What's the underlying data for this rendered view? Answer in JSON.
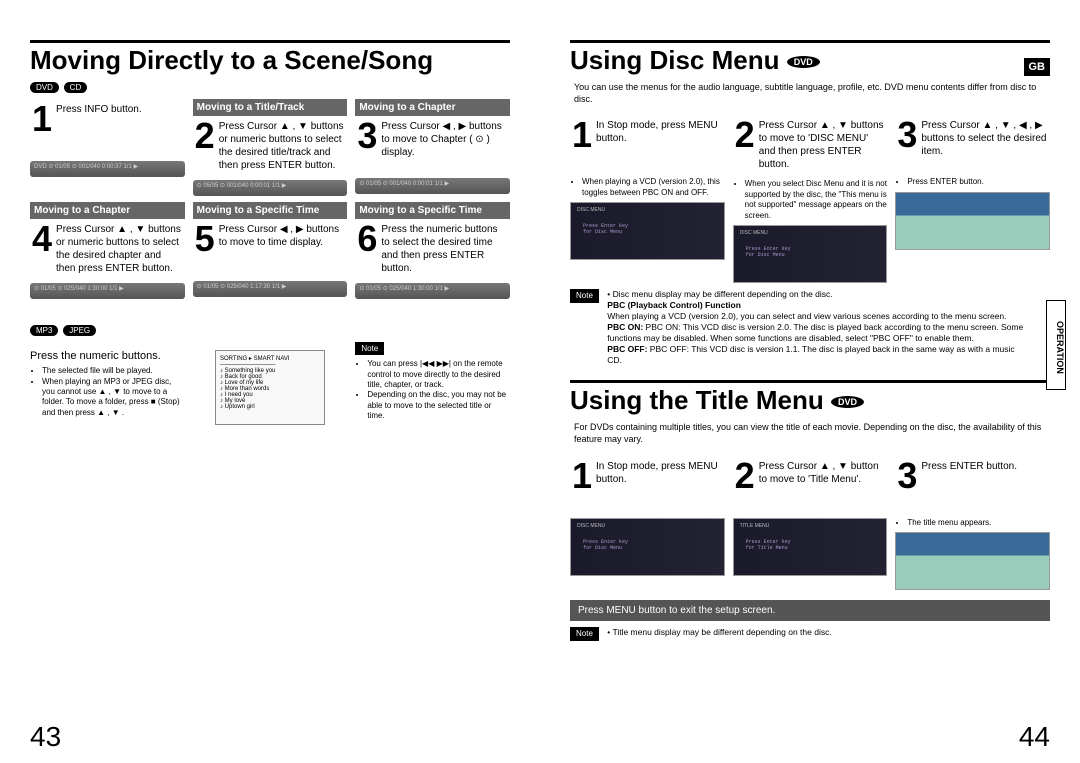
{
  "left": {
    "main_title_a": "Moving Directly to a Scene/Song",
    "pills": [
      "DVD",
      "CD"
    ],
    "row1": [
      {
        "num": "1",
        "head": "",
        "text": "Press INFO button."
      },
      {
        "num": "2",
        "head": "Moving to a Title/Track",
        "text": "Press Cursor ▲ , ▼ buttons or numeric buttons to select the desired title/track and then press ENTER button."
      },
      {
        "num": "3",
        "head": "Moving to a Chapter",
        "text": "Press Cursor ◀ , ▶ buttons to move to Chapter ( ⊙ ) display."
      }
    ],
    "row2": [
      {
        "num": "4",
        "head": "Moving to a Chapter",
        "text": "Press Cursor ▲ , ▼ buttons or numeric buttons to select the desired chapter and then press ENTER button."
      },
      {
        "num": "5",
        "head": "Moving to a Specific Time",
        "text": "Press Cursor ◀ , ▶ buttons to move to time display."
      },
      {
        "num": "6",
        "head": "Moving to a Specific Time",
        "text": "Press the numeric buttons to select the desired time and then press ENTER button."
      }
    ],
    "pills2": [
      "MP3",
      "JPEG"
    ],
    "numeric_text": "Press the numeric buttons.",
    "numeric_bullets": [
      "The selected file will be played.",
      "When playing an MP3 or JPEG disc, you cannot use ▲ , ▼ to move to a folder. To move a folder, press ■ (Stop) and then press ▲ , ▼ ."
    ],
    "note_label": "Note",
    "note_bullets": [
      "You can press |◀◀ ▶▶| on the remote control to move directly to the desired title, chapter, or track.",
      "Depending on the disc, you may not be able to move to the selected title or time."
    ],
    "page_num": "43"
  },
  "right": {
    "gb": "GB",
    "oper_tab": "OPERATION",
    "disc": {
      "title": "Using Disc Menu",
      "badge": "DVD",
      "sub": "You can use the menus for the audio language, subtitle language, profile, etc. DVD menu contents differ from disc to disc.",
      "steps": [
        {
          "num": "1",
          "text": "In Stop mode, press MENU button.",
          "bullet": "When playing a VCD (version 2.0), this toggles between PBC ON and OFF.",
          "tv_text": "Disc Menu\\n\\nPress Enter key\\nfor Disc Menu"
        },
        {
          "num": "2",
          "text": "Press Cursor ▲ , ▼ buttons to move to 'DISC MENU' and then press ENTER button.",
          "bullet": "When you select Disc Menu and it is not supported by the disc, the \"This menu is not supported\" message appears on the screen.",
          "tv_text": "Disc Menu\\n\\nPress Enter key\\nfor Disc Menu"
        },
        {
          "num": "3",
          "text": "Press Cursor ▲ , ▼ , ◀ , ▶ buttons to select the desired item.",
          "bullet": "Press ENTER button.",
          "dolphin": true
        }
      ],
      "note_label": "Note",
      "notes": [
        "Disc menu display may be different depending on the disc.",
        "PBC (Playback Control) Function",
        "When playing a VCD (version 2.0), you can select and view various scenes according to the menu screen.",
        "PBC ON: This VCD disc is version 2.0. The disc is played back according to the menu screen. Some functions may be disabled. When some functions are disabled, select \"PBC OFF\" to enable them.",
        "PBC OFF: This VCD disc is version 1.1. The disc is played back in the same way as with a music CD."
      ]
    },
    "title_menu": {
      "title": "Using the Title Menu",
      "badge": "DVD",
      "sub": "For DVDs containing multiple titles, you can view the title of each movie. Depending on the disc, the availability of this feature may vary.",
      "steps": [
        {
          "num": "1",
          "text": "In Stop mode, press MENU button.",
          "tv_text": "Disc Menu\\n\\nPress Enter key\\nfor Disc Menu"
        },
        {
          "num": "2",
          "text": "Press Cursor ▲ , ▼ button to move to 'Title Menu'.",
          "tv_text": "Title Menu\\n\\nPress Enter key\\nfor Title Menu"
        },
        {
          "num": "3",
          "text": "Press ENTER button.",
          "bullet": "The title menu appears.",
          "dolphin": true
        }
      ],
      "exit": "Press MENU button to exit the setup screen.",
      "note_label": "Note",
      "note": "Title menu display may be different depending on the disc."
    },
    "page_num": "44"
  }
}
